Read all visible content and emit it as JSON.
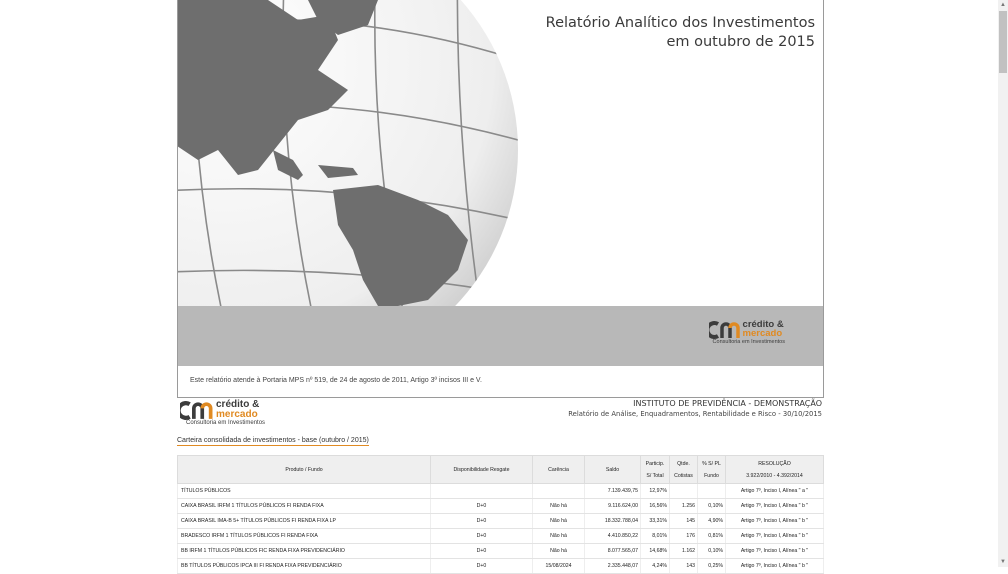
{
  "cover": {
    "title_line1": "Relatório Analítico dos Investimentos",
    "title_line2": "em outubro de 2015",
    "footnote": "Este relatório atende à Portaria MPS nº 519, de 24 de agosto de 2011, Artigo 3º incisos III e V."
  },
  "logo": {
    "line1": "crédito &",
    "line2": "mercado",
    "tagline": "Consultoria em Investimentos"
  },
  "institute": {
    "name": "INSTITUTO DE PREVIDÊNCIA - DEMONSTRAÇÃO",
    "subtitle": "Relatório de Análise, Enquadramentos, Rentabilidade e Risco - 30/10/2015"
  },
  "caption": "Carteira consolidada de investimentos - base (outubro / 2015)",
  "table": {
    "headers": {
      "produto": "Produto / Fundo",
      "disponibilidade": "Disponibilidade Resgate",
      "carencia": "Carência",
      "saldo": "Saldo",
      "particip_1": "Particip.",
      "particip_2": "S/ Total",
      "qtde_1": "Qtde.",
      "qtde_2": "Cotistas",
      "pl_1": "% S/ PL",
      "pl_2": "Fundo",
      "resolucao_1": "RESOLUÇÃO",
      "resolucao_2": "3.922/2010 - 4.392/2014"
    },
    "rows": [
      {
        "produto": "TÍTULOS PÚBLICOS",
        "disp": "",
        "carencia": "",
        "saldo": "7.139.439,75",
        "particip": "12,97%",
        "qtde": "",
        "pl": "",
        "resolucao": "Artigo 7º, Inciso I, Alínea \" a \""
      },
      {
        "produto": "CAIXA BRASIL IRFM 1 TÍTULOS PÚBLICOS FI RENDA FIXA",
        "disp": "D+0",
        "carencia": "Não há",
        "saldo": "9.116.624,00",
        "particip": "16,56%",
        "qtde": "1.256",
        "pl": "0,10%",
        "resolucao": "Artigo 7º, Inciso I, Alínea \" b \""
      },
      {
        "produto": "CAIXA BRASIL IMA-B 5+ TÍTULOS PÚBLICOS FI RENDA FIXA LP",
        "disp": "D+0",
        "carencia": "Não há",
        "saldo": "18.332.788,04",
        "particip": "33,31%",
        "qtde": "145",
        "pl": "4,90%",
        "resolucao": "Artigo 7º, Inciso I, Alínea \" b \""
      },
      {
        "produto": "BRADESCO IRFM 1 TÍTULOS PÚBLICOS FI RENDA FIXA",
        "disp": "D+0",
        "carencia": "Não há",
        "saldo": "4.410.850,22",
        "particip": "8,01%",
        "qtde": "176",
        "pl": "0,81%",
        "resolucao": "Artigo 7º, Inciso I, Alínea \" b \""
      },
      {
        "produto": "BB IRFM 1 TÍTULOS PÚBLICOS FIC RENDA FIXA PREVIDENCIÁRIO",
        "disp": "D+0",
        "carencia": "Não há",
        "saldo": "8.077.565,07",
        "particip": "14,68%",
        "qtde": "1.162",
        "pl": "0,10%",
        "resolucao": "Artigo 7º, Inciso I, Alínea \" b \""
      },
      {
        "produto": "BB TÍTULOS PÚBLICOS IPCA III FI RENDA FIXA PREVIDENCIÁRIO",
        "disp": "D+0",
        "carencia": "15/08/2024",
        "saldo": "2.335.448,07",
        "particip": "4,24%",
        "qtde": "143",
        "pl": "0,25%",
        "resolucao": "Artigo 7º, Inciso I, Alínea \" b \""
      }
    ]
  }
}
